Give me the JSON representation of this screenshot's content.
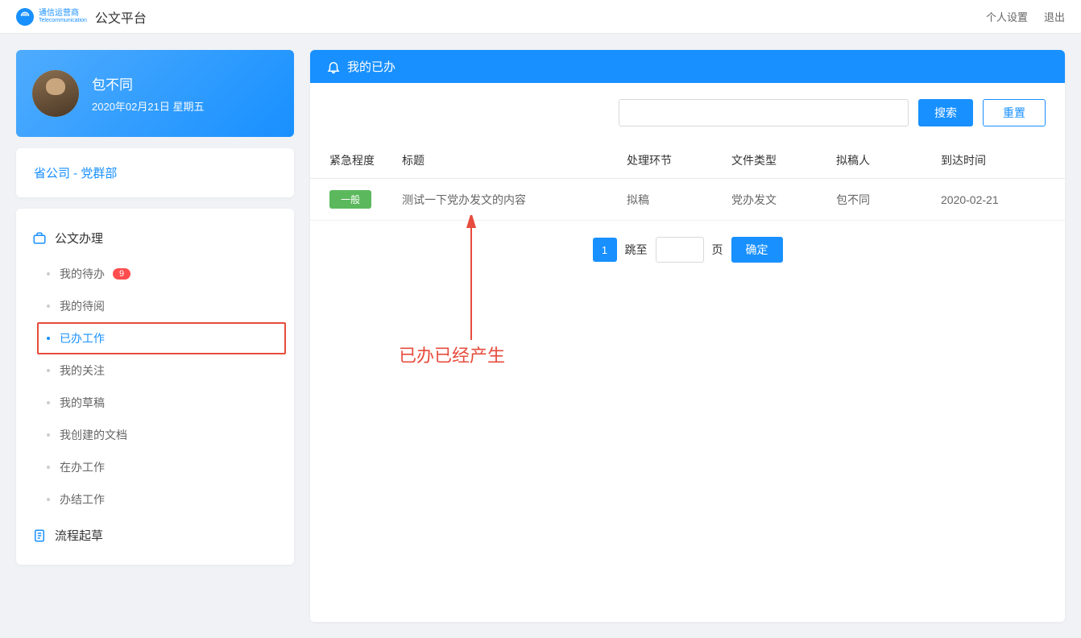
{
  "header": {
    "logo_cn": "通信运营商",
    "logo_en": "Telecommunication",
    "platform_title": "公文平台",
    "personal_settings": "个人设置",
    "logout": "退出"
  },
  "user": {
    "name": "包不同",
    "date_text": "2020年02月21日 星期五"
  },
  "dept": {
    "text": "省公司 - 党群部"
  },
  "sidebar": {
    "section_documents": "公文办理",
    "items": [
      {
        "label": "我的待办",
        "badge": "9",
        "active": false
      },
      {
        "label": "我的待阅",
        "badge": null,
        "active": false
      },
      {
        "label": "已办工作",
        "badge": null,
        "active": true
      },
      {
        "label": "我的关注",
        "badge": null,
        "active": false
      },
      {
        "label": "我的草稿",
        "badge": null,
        "active": false
      },
      {
        "label": "我创建的文档",
        "badge": null,
        "active": false
      },
      {
        "label": "在办工作",
        "badge": null,
        "active": false
      },
      {
        "label": "办结工作",
        "badge": null,
        "active": false
      }
    ],
    "section_draft": "流程起草"
  },
  "content": {
    "header_title": "我的已办",
    "search_btn": "搜索",
    "reset_btn": "重置",
    "columns": {
      "urgency": "紧急程度",
      "title": "标题",
      "stage": "处理环节",
      "type": "文件类型",
      "author": "拟稿人",
      "arrive": "到达时间"
    },
    "rows": [
      {
        "urgency": "一般",
        "title": "测试一下党办发文的内容",
        "stage": "拟稿",
        "type": "党办发文",
        "author": "包不同",
        "arrive": "2020-02-21"
      }
    ],
    "pagination": {
      "current": "1",
      "jump_label": "跳至",
      "page_label": "页",
      "confirm": "确定"
    }
  },
  "annotation": {
    "text": "已办已经产生"
  }
}
